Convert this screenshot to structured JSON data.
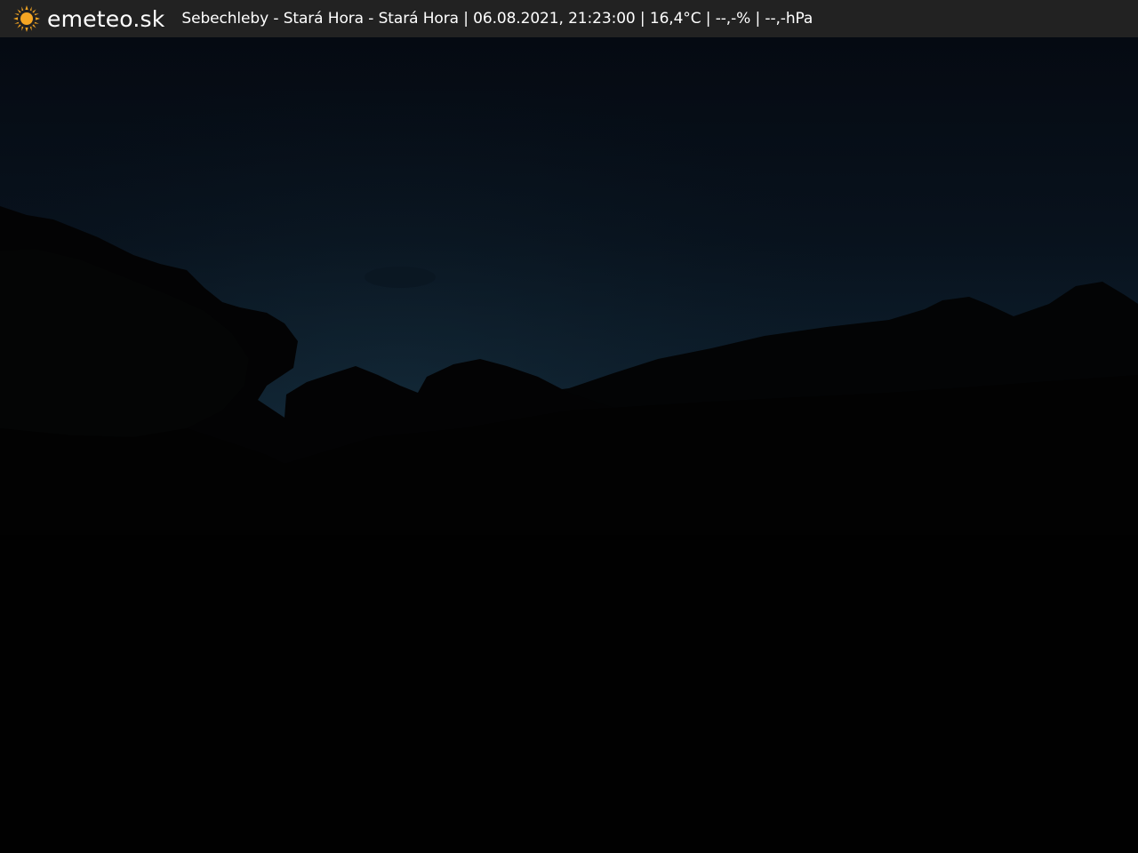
{
  "header": {
    "brand": "emeteo.sk",
    "logo_icon": "sun-icon",
    "caption": "Sebechleby - Stará Hora - Stará Hora | 06.08.2021, 21:23:00 | 16,4°C | --,-% | --,-hPa"
  },
  "colors": {
    "bar_background": "#222222",
    "sun": "#f5a623",
    "sky_top": "#050b14",
    "sky_horizon": "#0f2233",
    "ground": "#020202"
  }
}
